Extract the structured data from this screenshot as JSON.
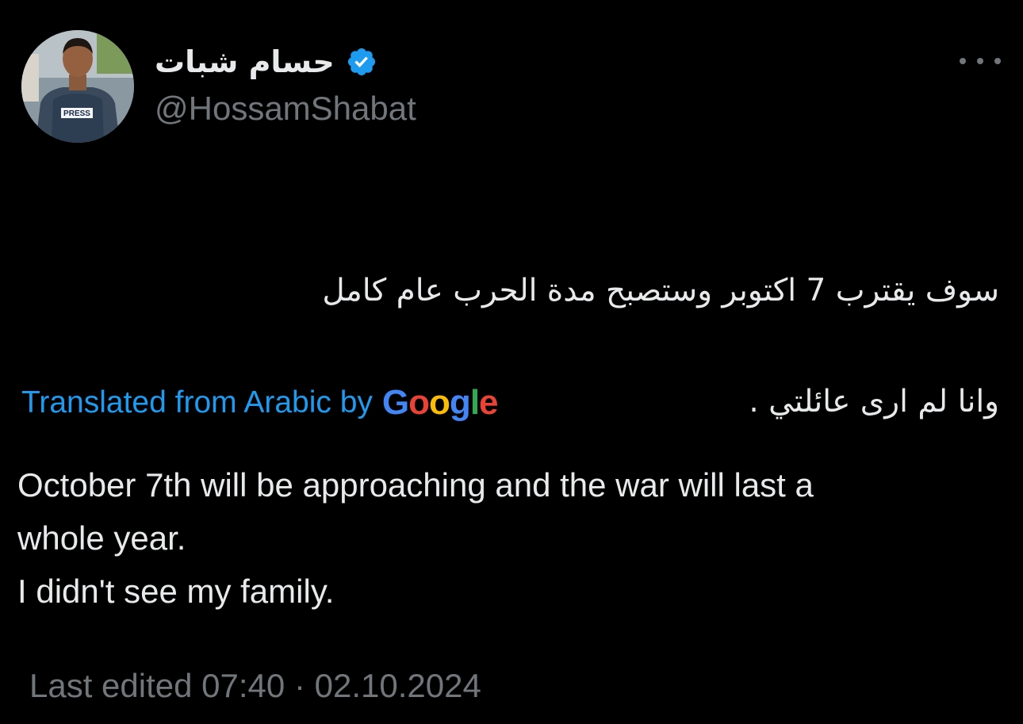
{
  "tweet": {
    "author": {
      "display_name": "حسام شبات",
      "handle": "@HossamShabat",
      "verified": true,
      "verified_icon": "verified-badge-icon",
      "avatar_icon": "avatar-press-vest",
      "avatar_press_text": "PRESS"
    },
    "more_icon": "more-horizontal-icon",
    "text_arabic_lines": [
      "سوف يقترب 7 اكتوبر وستصبح مدة الحرب عام كامل",
      "وانا لم ارى عائلتي ."
    ],
    "translation": {
      "label": "Translated from Arabic by",
      "provider": "Google",
      "provider_letters": [
        "G",
        "o",
        "o",
        "g",
        "l",
        "e"
      ]
    },
    "text_english_lines": [
      "October 7th will be approaching and the war will last a",
      "whole year.",
      "I didn't see my family."
    ],
    "edited": {
      "label": "Last edited",
      "time": "07:40",
      "separator": "·",
      "date": "02.10.2024"
    }
  },
  "colors": {
    "background": "#000000",
    "text_primary": "#e7e9ea",
    "text_secondary": "#71767b",
    "accent_blue": "#1d9bf0",
    "google_blue": "#4285f4",
    "google_red": "#ea4335",
    "google_yellow": "#fbbc05",
    "google_green": "#34a853"
  }
}
